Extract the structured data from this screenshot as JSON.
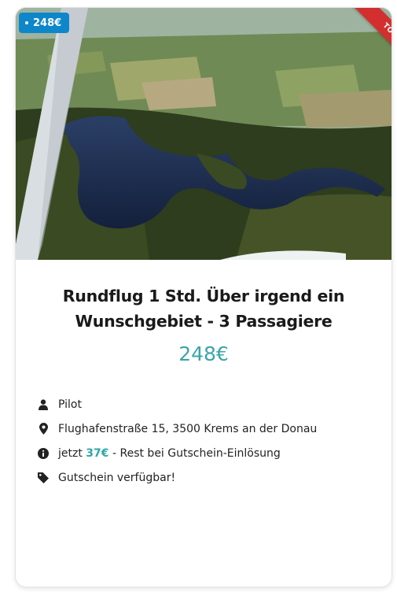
{
  "listing": {
    "badge_price": "248€",
    "ribbon_label": "TOP",
    "title": "Rundflug 1 Std. Über irgend ein Wunschgebiet - 3 Passagiere",
    "price": "248€",
    "details": {
      "host": "Pilot",
      "address": "Flughafenstraße 15, 3500 Krems an der Donau",
      "deposit_prefix": "jetzt",
      "deposit_amount": "37€",
      "deposit_suffix": "- Rest bei Gutschein-Einlösung",
      "voucher": "Gutschein verfügbar!"
    }
  },
  "colors": {
    "badge": "#0d87c9",
    "ribbon": "#d32f2f",
    "price": "#3aa6a8",
    "accent": "#2fa7a7"
  },
  "icons": [
    "user-icon",
    "map-marker-icon",
    "info-circle-icon",
    "tag-icon"
  ]
}
